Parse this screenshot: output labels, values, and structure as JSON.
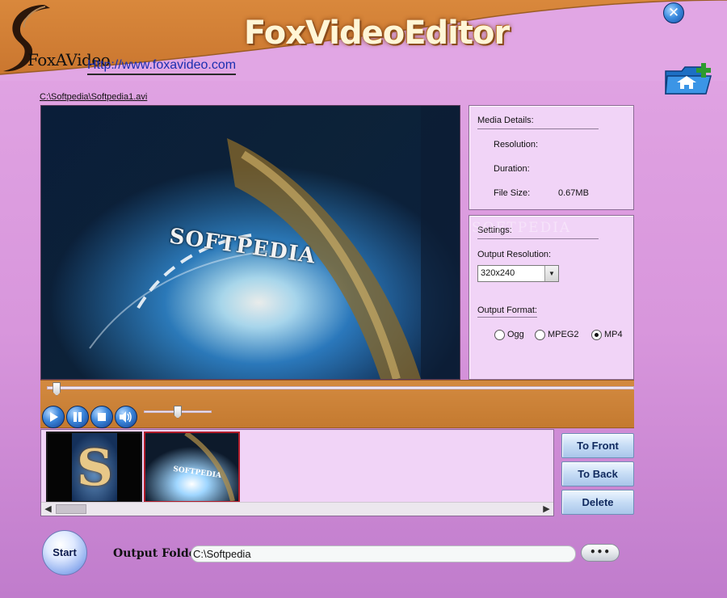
{
  "header": {
    "title": "FoxVideoEditor",
    "logo_text": "FoxAVideo",
    "url": "Http://www.foxavideo.com",
    "close_symbol": "✕",
    "add_folder_icon": "add-folder-icon"
  },
  "file": {
    "path": "C:\\Softpedia\\Softpedia1.avi"
  },
  "video": {
    "overlay_text": "SOFTPEDIA"
  },
  "media_details": {
    "heading": "Media Details:",
    "resolution_label": "Resolution:",
    "resolution_value": "",
    "duration_label": "Duration:",
    "duration_value": "",
    "filesize_label": "File Size:",
    "filesize_value": "0.67MB"
  },
  "settings": {
    "heading": "Settings:",
    "watermark": "SOFTPEDIA",
    "output_resolution_label": "Output Resolution:",
    "output_resolution_value": "320x240",
    "output_format_label": "Output Format:",
    "formats": [
      "Ogg",
      "MPEG2",
      "MP4"
    ],
    "selected_format": "MP4"
  },
  "playback": {
    "seek_position": 0.01,
    "volume": 0.5,
    "icons": [
      "play-icon",
      "pause-icon",
      "stop-icon",
      "volume-icon"
    ]
  },
  "thumbnails": {
    "items": [
      "S",
      "SOFTPEDIA"
    ]
  },
  "actions": {
    "to_front": "To Front",
    "to_back": "To Back",
    "delete": "Delete"
  },
  "footer": {
    "start_label": "Start",
    "output_folder_label": "Output Folder",
    "output_folder_value": "C:\\Softpedia",
    "browse_label": "•••"
  },
  "colors": {
    "header_orange": "#d9883c",
    "background_pink": "#d896dc",
    "panel_pink": "#f1d4f7",
    "button_blue": "#3a85da"
  }
}
